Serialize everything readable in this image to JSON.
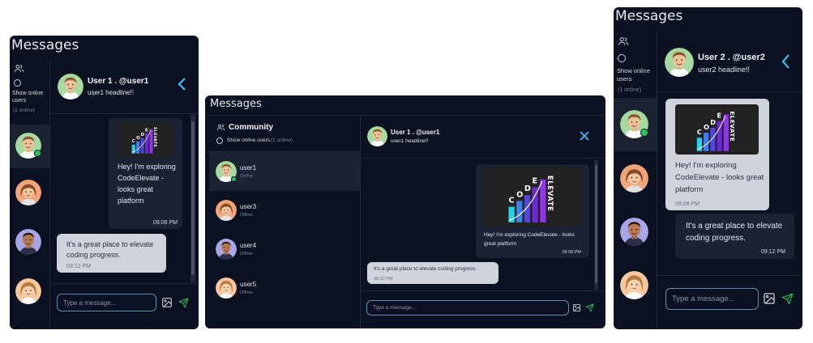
{
  "title": "Messages",
  "panel_left": {
    "sidebar": {
      "show_online_label": "Show online users",
      "online_count": "(1 online)"
    },
    "header": {
      "name": "User 1 . @user1",
      "headline": "user1 headline!!"
    },
    "messages": [
      {
        "text": "Hey! I'm exploring CodeElevate - looks great platform",
        "time": "09:08 PM"
      },
      {
        "text": "It's a great place to elevate coding progress.",
        "time": "09:12 PM"
      }
    ],
    "input_placeholder": "Type a message..."
  },
  "panel_middle": {
    "sidebar": {
      "title": "Community",
      "show_online_label": "Show online users",
      "online_count": "(1 online)",
      "users": [
        {
          "name": "user1",
          "status": "Online"
        },
        {
          "name": "user3",
          "status": "Offline"
        },
        {
          "name": "user4",
          "status": "Offline"
        },
        {
          "name": "user5",
          "status": "Offline"
        }
      ]
    },
    "header": {
      "name": "User 1 . @user1",
      "headline": "user1 headline!!"
    },
    "messages": [
      {
        "text": "Hey! I'm exploring CodeElevate - looks great platform",
        "time": "09:08 PM"
      },
      {
        "text": "It's a great place to elevate coding progress.",
        "time": "09:12 PM"
      }
    ],
    "input_placeholder": "Type a message..."
  },
  "panel_right": {
    "sidebar": {
      "show_online_label": "Show online users",
      "online_count": "(1 online)"
    },
    "header": {
      "name": "User 2 . @user2",
      "headline": "user2 headline!!"
    },
    "messages": [
      {
        "text": "Hey! I'm exploring CodeElevate - looks great platform",
        "time": "09:08 PM"
      },
      {
        "text": "It's a great place to elevate coding progress.",
        "time": "09:12 PM"
      }
    ],
    "input_placeholder": "Type a message..."
  },
  "logo": {
    "letters_cod": "C O D E",
    "letters_vertical": "ELEVATE"
  },
  "colors": {
    "background": "#0b1120",
    "accent": "#38bdf8",
    "online": "#22c55e",
    "border": "#1f2a3c"
  }
}
